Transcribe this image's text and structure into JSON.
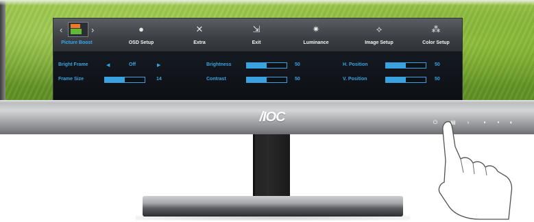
{
  "brand": "/IOC",
  "osd": {
    "tabs": [
      {
        "label": "Picture Boost",
        "icon": "picture-boost-icon",
        "active": true
      },
      {
        "label": "OSD Setup",
        "icon": "osd-setup-icon",
        "active": false
      },
      {
        "label": "Extra",
        "icon": "extra-icon",
        "active": false
      },
      {
        "label": "Exit",
        "icon": "exit-icon",
        "active": false
      },
      {
        "label": "Luminance",
        "icon": "luminance-icon",
        "active": false
      },
      {
        "label": "Image Setup",
        "icon": "image-setup-icon",
        "active": false
      },
      {
        "label": "Color Setup",
        "icon": "color-setup-icon",
        "active": false
      }
    ],
    "settings": {
      "bright_frame": {
        "label": "Bright Frame",
        "value": "Off"
      },
      "frame_size": {
        "label": "Frame Size",
        "value": "14",
        "level": 0.5
      },
      "brightness": {
        "label": "Brightness",
        "value": "50",
        "level": 0.5
      },
      "contrast": {
        "label": "Contrast",
        "value": "50",
        "level": 0.5
      },
      "h_position": {
        "label": "H. Position",
        "value": "50",
        "level": 0.5
      },
      "v_position": {
        "label": "V. Position",
        "value": "50",
        "level": 0.5
      }
    }
  },
  "colors": {
    "accent": "#3aa3df",
    "osd_background": "#101318",
    "orange": "#f07a22",
    "green": "#62b935"
  },
  "bezel_buttons": [
    "power-icon",
    "menu-icon",
    "right-icon",
    "square-icon",
    "circle-icon",
    "auto-icon"
  ]
}
